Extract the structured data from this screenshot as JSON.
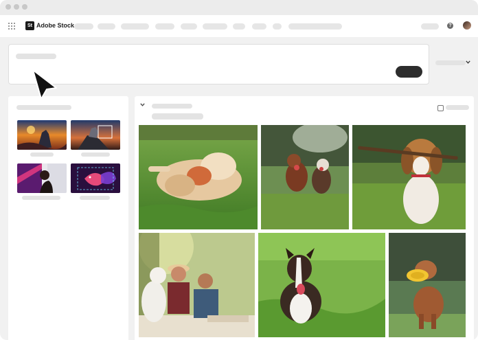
{
  "app": {
    "brand_logo": "St",
    "brand_name": "Adobe Stock"
  },
  "icons": {
    "apps": "apps-grid-icon",
    "help": "help-icon",
    "chevron": "chevron-down-icon",
    "cursor": "cursor-arrow-icon",
    "collapse": "chevron-down-icon",
    "checkbox": "checkbox-icon"
  },
  "colors": {
    "search_button": "#2d2d2d",
    "placeholder": "#e3e3e3",
    "background": "#f1f1f1"
  },
  "help_glyph": "?",
  "left_thumbnails": [
    {
      "name": "thumbnail-fantasy-wolf-sunset"
    },
    {
      "name": "thumbnail-wolf-on-rock"
    },
    {
      "name": "thumbnail-woman-profile-purple"
    },
    {
      "name": "thumbnail-betta-fish"
    }
  ],
  "results": [
    {
      "name": "photo-golden-retriever-rolling-with-toy"
    },
    {
      "name": "photo-two-puppies-running"
    },
    {
      "name": "photo-beagle-with-stick"
    },
    {
      "name": "photo-couple-with-dog-picnic"
    },
    {
      "name": "photo-border-collie-in-grass"
    },
    {
      "name": "photo-dog-with-frisbee"
    }
  ]
}
